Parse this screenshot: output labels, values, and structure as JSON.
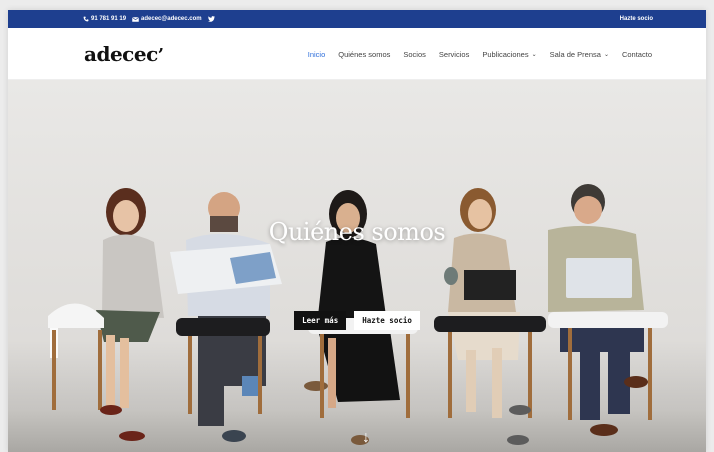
{
  "topbar": {
    "phone": "91 781 91 19",
    "email": "adecec@adecec.com",
    "cta": "Hazte socio"
  },
  "header": {
    "logo": "adecec",
    "logo_mark": "’"
  },
  "nav": {
    "items": [
      {
        "label": "Inicio",
        "active": true
      },
      {
        "label": "Quiénes somos"
      },
      {
        "label": "Socios"
      },
      {
        "label": "Servicios"
      },
      {
        "label": "Publicaciones",
        "dropdown": true
      },
      {
        "label": "Sala de Prensa",
        "dropdown": true
      },
      {
        "label": "Contacto"
      }
    ]
  },
  "hero": {
    "title": "Quiénes somos",
    "button_primary": "Leer más",
    "button_secondary": "Hazte socio"
  },
  "colors": {
    "topbar": "#1e3f8f",
    "accent": "#2f6fdb"
  },
  "icons": {
    "phone": "phone-icon",
    "mail": "mail-icon",
    "twitter": "twitter-icon",
    "scroll": "arrow-down-icon"
  }
}
